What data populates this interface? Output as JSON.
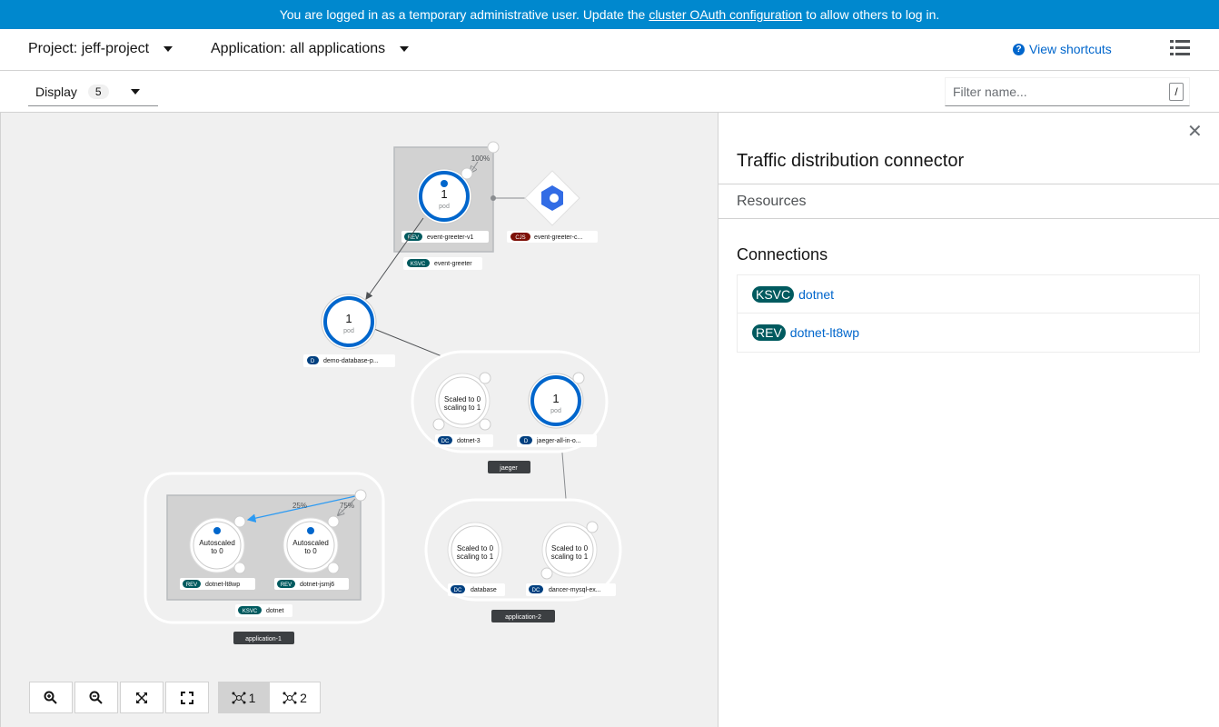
{
  "banner": {
    "prefix": "You are logged in as a temporary administrative user. Update the",
    "link": "cluster OAuth configuration",
    "suffix": "to allow others to log in."
  },
  "topbar": {
    "project": "Project: jeff-project",
    "application": "Application: all applications",
    "shortcuts": "View shortcuts"
  },
  "toolbar": {
    "display_label": "Display",
    "display_count": "5",
    "filter_placeholder": "Filter name...",
    "filter_shortcut": "/"
  },
  "panel": {
    "title": "Traffic distribution connector",
    "tab": "Resources",
    "connections_title": "Connections",
    "connections": [
      {
        "badge": "KSVC",
        "name": "dotnet"
      },
      {
        "badge": "REV",
        "name": "dotnet-lt8wp"
      }
    ]
  },
  "controls": {
    "layout1": "1",
    "layout2": "2"
  },
  "topology": {
    "ev_pct": "100%",
    "ev_rev": "event-greeter-v1",
    "ev_ksvc": "event-greeter",
    "ev_pod_count": "1",
    "pod_word": "pod",
    "cj_label": "event-greeter-c...",
    "demo_count": "1",
    "demo_label": "demo-database-p...",
    "jaeger_group": "jaeger",
    "dotnet3_text1": "Scaled to 0",
    "dotnet3_text2": "scaling to 1",
    "dotnet3_label": "dotnet-3",
    "jaeger_count": "1",
    "jaeger_label": "jaeger-all-in-o...",
    "app1_group": "application-1",
    "app1_pct1": "25%",
    "app1_pct2": "75%",
    "auto1": "Autoscaled",
    "auto2": "to 0",
    "lt8wp": "dotnet-lt8wp",
    "jsmj6": "dotnet-jsmj6",
    "ksvc_dotnet": "dotnet",
    "app2_group": "application-2",
    "db_label": "database",
    "dancer_label": "dancer-mysql-ex...",
    "badge_rev": "REV",
    "badge_ksvc": "KSVC",
    "badge_cj": "CJS",
    "badge_d": "D",
    "badge_dc": "DC",
    "zero_word": "to 0"
  }
}
